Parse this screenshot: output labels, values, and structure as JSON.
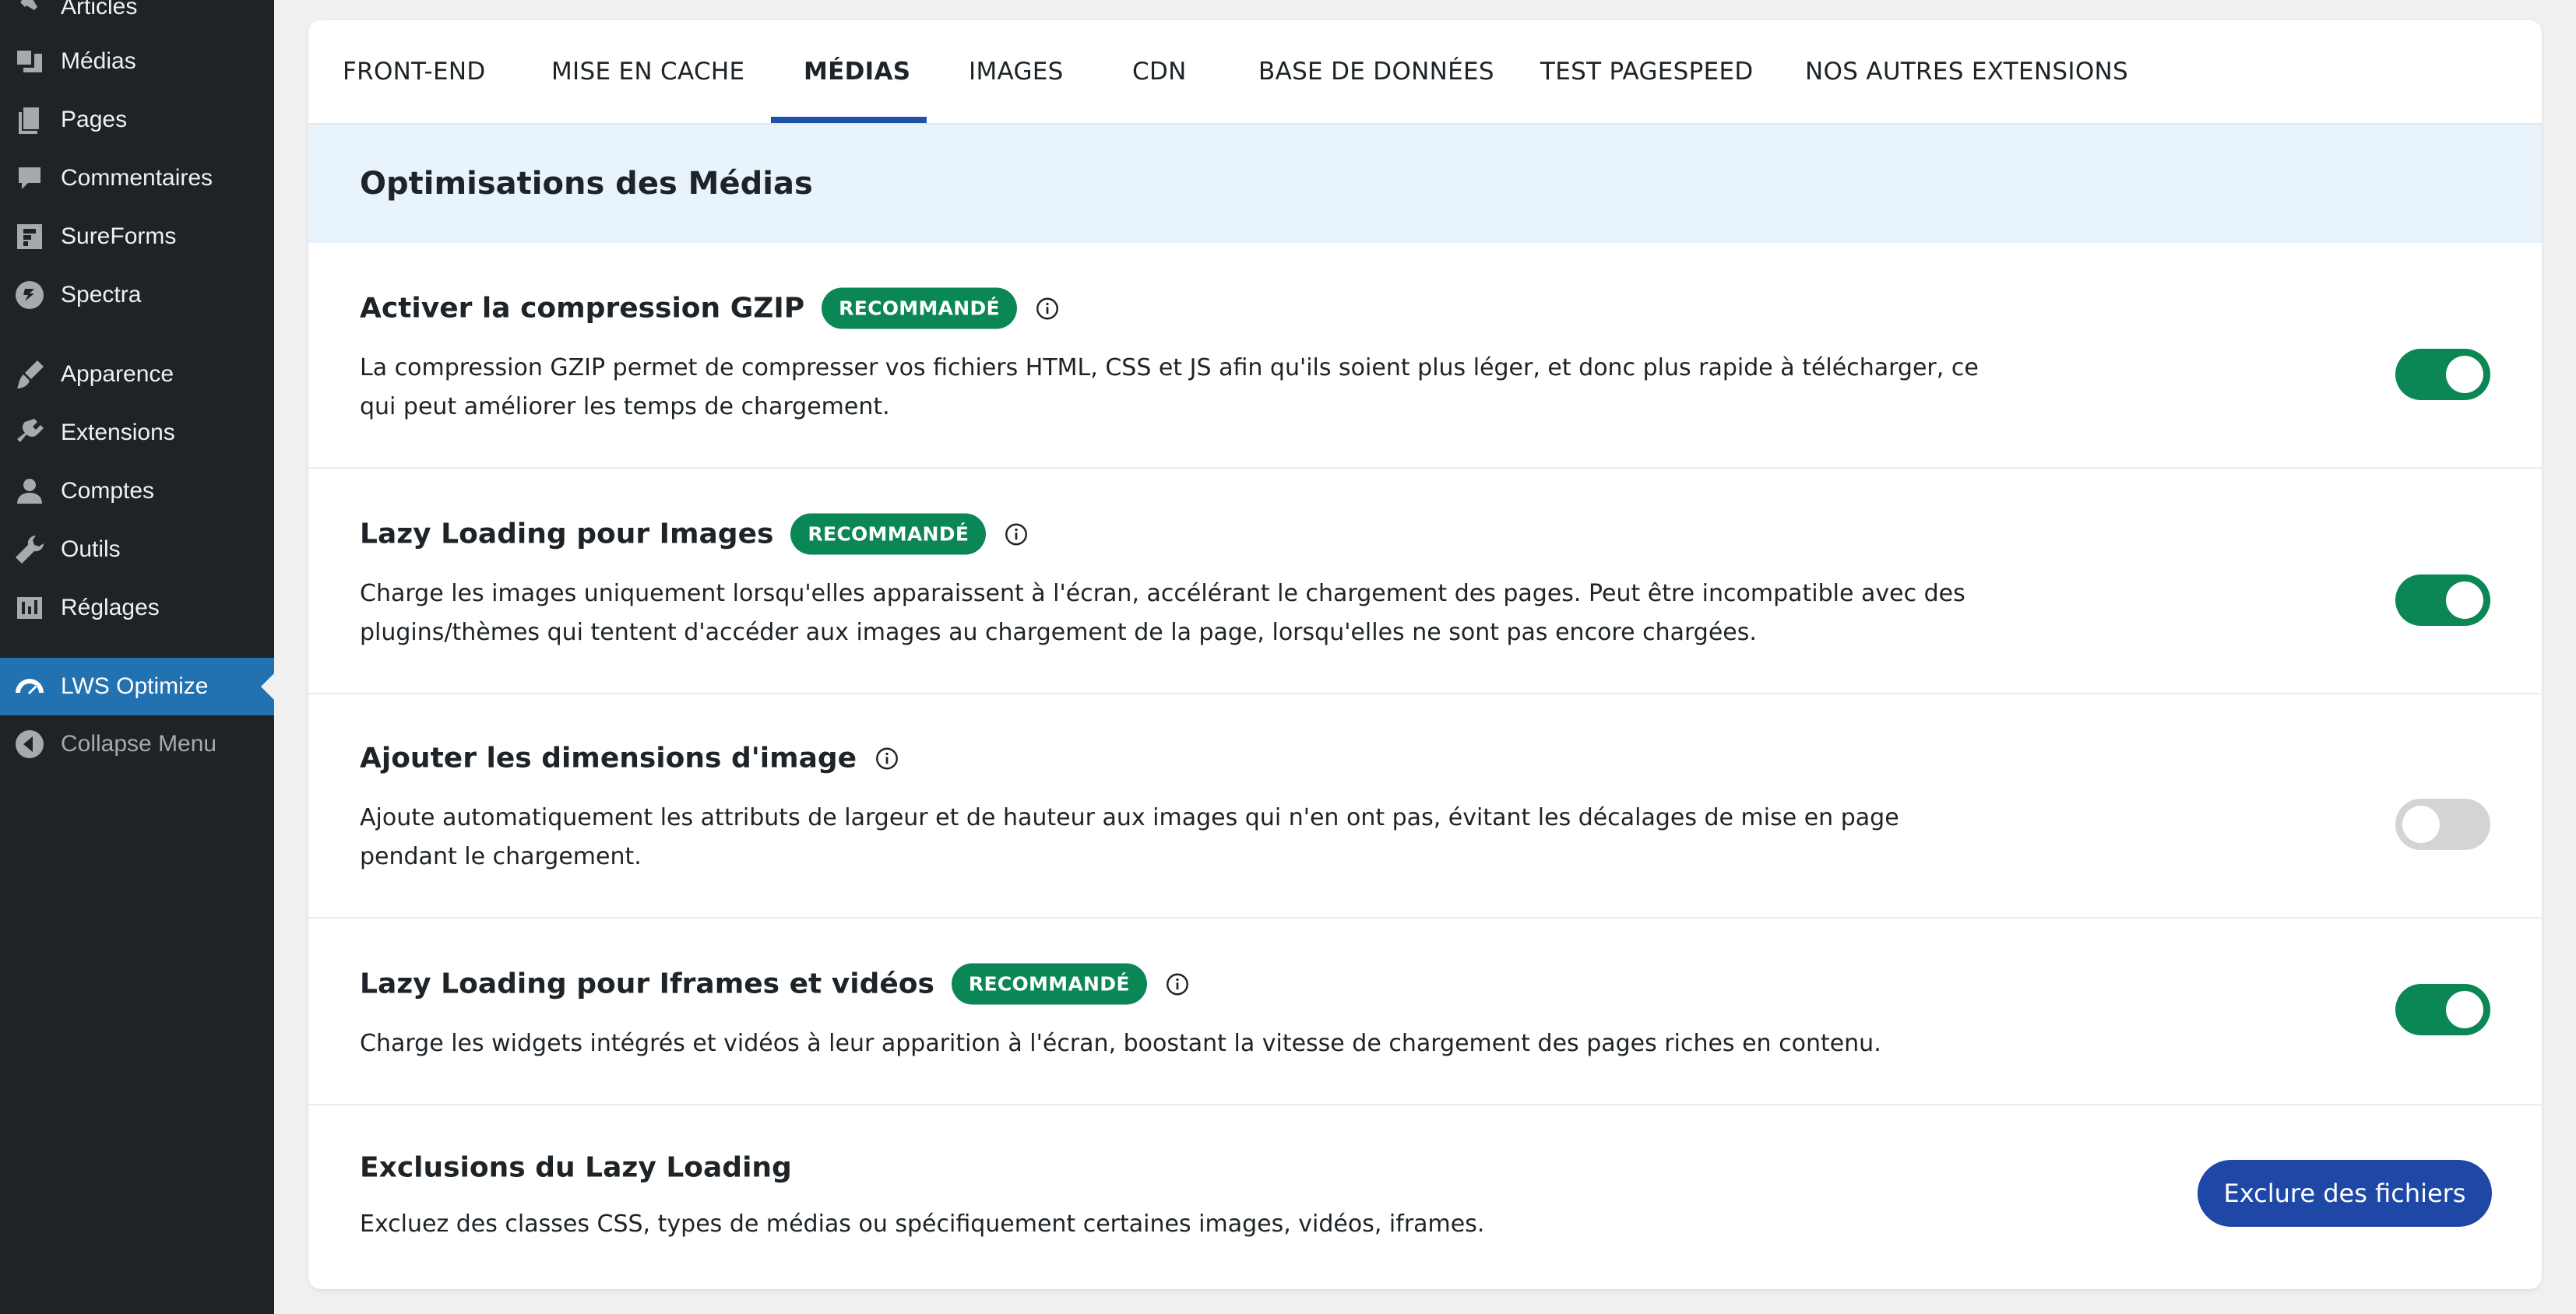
{
  "sidebar": {
    "items": [
      {
        "label": "Articles",
        "icon": "pin-icon"
      },
      {
        "label": "Médias",
        "icon": "media-icon"
      },
      {
        "label": "Pages",
        "icon": "pages-icon"
      },
      {
        "label": "Commentaires",
        "icon": "comment-icon"
      },
      {
        "label": "SureForms",
        "icon": "sureforms-icon"
      },
      {
        "label": "Spectra",
        "icon": "spectra-icon"
      },
      {
        "label": "Apparence",
        "icon": "brush-icon"
      },
      {
        "label": "Extensions",
        "icon": "plugin-icon"
      },
      {
        "label": "Comptes",
        "icon": "user-icon"
      },
      {
        "label": "Outils",
        "icon": "wrench-icon"
      },
      {
        "label": "Réglages",
        "icon": "settings-icon"
      },
      {
        "label": "LWS Optimize",
        "icon": "gauge-icon",
        "active": true
      },
      {
        "label": "Collapse Menu",
        "icon": "collapse-icon"
      }
    ]
  },
  "tabs": [
    {
      "label": "FRONT-END"
    },
    {
      "label": "MISE EN CACHE"
    },
    {
      "label": "MÉDIAS",
      "active": true
    },
    {
      "label": "IMAGES"
    },
    {
      "label": "CDN"
    },
    {
      "label": "BASE DE DONNÉES"
    },
    {
      "label": "TEST PAGESPEED"
    },
    {
      "label": "NOS AUTRES EXTENSIONS"
    }
  ],
  "section": {
    "title": "Optimisations des Médias"
  },
  "badge_label": "RECOMMANDÉ",
  "options": [
    {
      "title": "Activer la compression GZIP",
      "recommended": true,
      "desc_line1": "La compression GZIP permet de compresser vos fichiers HTML, CSS et JS afin qu'ils soient plus léger, et donc plus rapide à télécharger, ce",
      "desc_line2": "qui peut améliorer les temps de chargement.",
      "enabled": true
    },
    {
      "title": "Lazy Loading pour Images",
      "recommended": true,
      "desc_line1": "Charge les images uniquement lorsqu'elles apparaissent à l'écran, accélérant le chargement des pages. Peut être incompatible avec des",
      "desc_line2": "plugins/thèmes qui tentent d'accéder aux images au chargement de la page, lorsqu'elles ne sont pas encore chargées.",
      "enabled": true
    },
    {
      "title": "Ajouter les dimensions d'image",
      "recommended": false,
      "desc_line1": "Ajoute automatiquement les attributs de largeur et de hauteur aux images qui n'en ont pas, évitant les décalages de mise en page",
      "desc_line2": "pendant le chargement.",
      "enabled": false
    },
    {
      "title": "Lazy Loading pour Iframes et vidéos",
      "recommended": true,
      "desc_line1": "Charge les widgets intégrés et vidéos à leur apparition à l'écran, boostant la vitesse de chargement des pages riches en contenu.",
      "enabled": true
    },
    {
      "title": "Exclusions du Lazy Loading",
      "desc_line1": "Excluez des classes CSS, types de médias ou spécifiquement certaines images, vidéos, iframes.",
      "button_label": "Exclure des fichiers"
    }
  ],
  "colors": {
    "accent_green": "#0a8754",
    "primary_blue": "#1f47a5",
    "sidebar_bg": "#1d2327",
    "sidebar_active": "#2271b1",
    "section_bg": "#e8f3fc"
  }
}
